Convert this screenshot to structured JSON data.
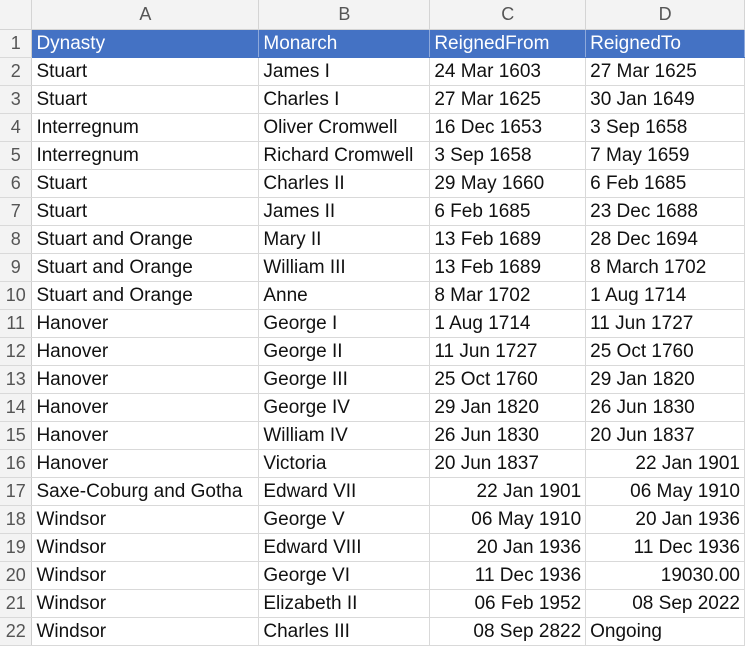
{
  "columns": [
    "A",
    "B",
    "C",
    "D"
  ],
  "header": [
    "Dynasty",
    "Monarch",
    "ReignedFrom",
    "ReignedTo"
  ],
  "rows": [
    [
      "Stuart",
      "James I",
      "24 Mar 1603",
      "27 Mar 1625"
    ],
    [
      "Stuart",
      "Charles I",
      "27 Mar 1625",
      "30 Jan 1649"
    ],
    [
      "Interregnum",
      "Oliver Cromwell",
      "16 Dec 1653",
      "3 Sep 1658"
    ],
    [
      "Interregnum",
      "Richard Cromwell",
      "3 Sep 1658",
      "7 May 1659"
    ],
    [
      "Stuart",
      "Charles II",
      "29 May 1660",
      "6 Feb 1685"
    ],
    [
      "Stuart",
      "James II",
      "6 Feb 1685",
      "23 Dec 1688"
    ],
    [
      "Stuart and Orange",
      "Mary II",
      "13 Feb 1689",
      "28 Dec 1694"
    ],
    [
      "Stuart and Orange",
      "William III",
      "13 Feb 1689",
      "8 March 1702"
    ],
    [
      "Stuart and Orange",
      "Anne",
      "8 Mar 1702",
      "1 Aug 1714"
    ],
    [
      "Hanover",
      "George I",
      "1 Aug 1714",
      "11 Jun 1727"
    ],
    [
      "Hanover",
      "George II",
      "11 Jun 1727",
      "25 Oct 1760"
    ],
    [
      "Hanover",
      "George III",
      "25 Oct 1760",
      "29 Jan 1820"
    ],
    [
      "Hanover",
      "George IV",
      "29 Jan 1820",
      "26 Jun 1830"
    ],
    [
      "Hanover",
      "William IV",
      "26 Jun 1830",
      "20 Jun 1837"
    ],
    [
      "Hanover",
      "Victoria",
      "20 Jun 1837",
      "22 Jan 1901"
    ],
    [
      "Saxe-Coburg and Gotha",
      "Edward VII",
      "22 Jan 1901",
      "06 May 1910"
    ],
    [
      "Windsor",
      "George V",
      "06 May 1910",
      "20 Jan 1936"
    ],
    [
      "Windsor",
      "Edward VIII",
      "20 Jan 1936",
      "11 Dec 1936"
    ],
    [
      "Windsor",
      "George VI",
      "11 Dec 1936",
      "19030.00"
    ],
    [
      "Windsor",
      "Elizabeth II",
      "06 Feb 1952",
      "08 Sep 2022"
    ],
    [
      "Windsor",
      "Charles III",
      "08 Sep 2822",
      "Ongoing"
    ]
  ],
  "right_aligned": [
    [
      false,
      false,
      false,
      false
    ],
    [
      false,
      false,
      false,
      false
    ],
    [
      false,
      false,
      false,
      false
    ],
    [
      false,
      false,
      false,
      false
    ],
    [
      false,
      false,
      false,
      false
    ],
    [
      false,
      false,
      false,
      false
    ],
    [
      false,
      false,
      false,
      false
    ],
    [
      false,
      false,
      false,
      false
    ],
    [
      false,
      false,
      false,
      false
    ],
    [
      false,
      false,
      false,
      false
    ],
    [
      false,
      false,
      false,
      false
    ],
    [
      false,
      false,
      false,
      false
    ],
    [
      false,
      false,
      false,
      false
    ],
    [
      false,
      false,
      false,
      false
    ],
    [
      false,
      false,
      false,
      true
    ],
    [
      false,
      false,
      true,
      true
    ],
    [
      false,
      false,
      true,
      true
    ],
    [
      false,
      false,
      true,
      true
    ],
    [
      false,
      false,
      true,
      true
    ],
    [
      false,
      false,
      true,
      true
    ],
    [
      false,
      false,
      true,
      false
    ]
  ],
  "colors": {
    "header_fill": "#4472c4",
    "header_text": "#ffffff",
    "grid": "#d9d9d9"
  }
}
